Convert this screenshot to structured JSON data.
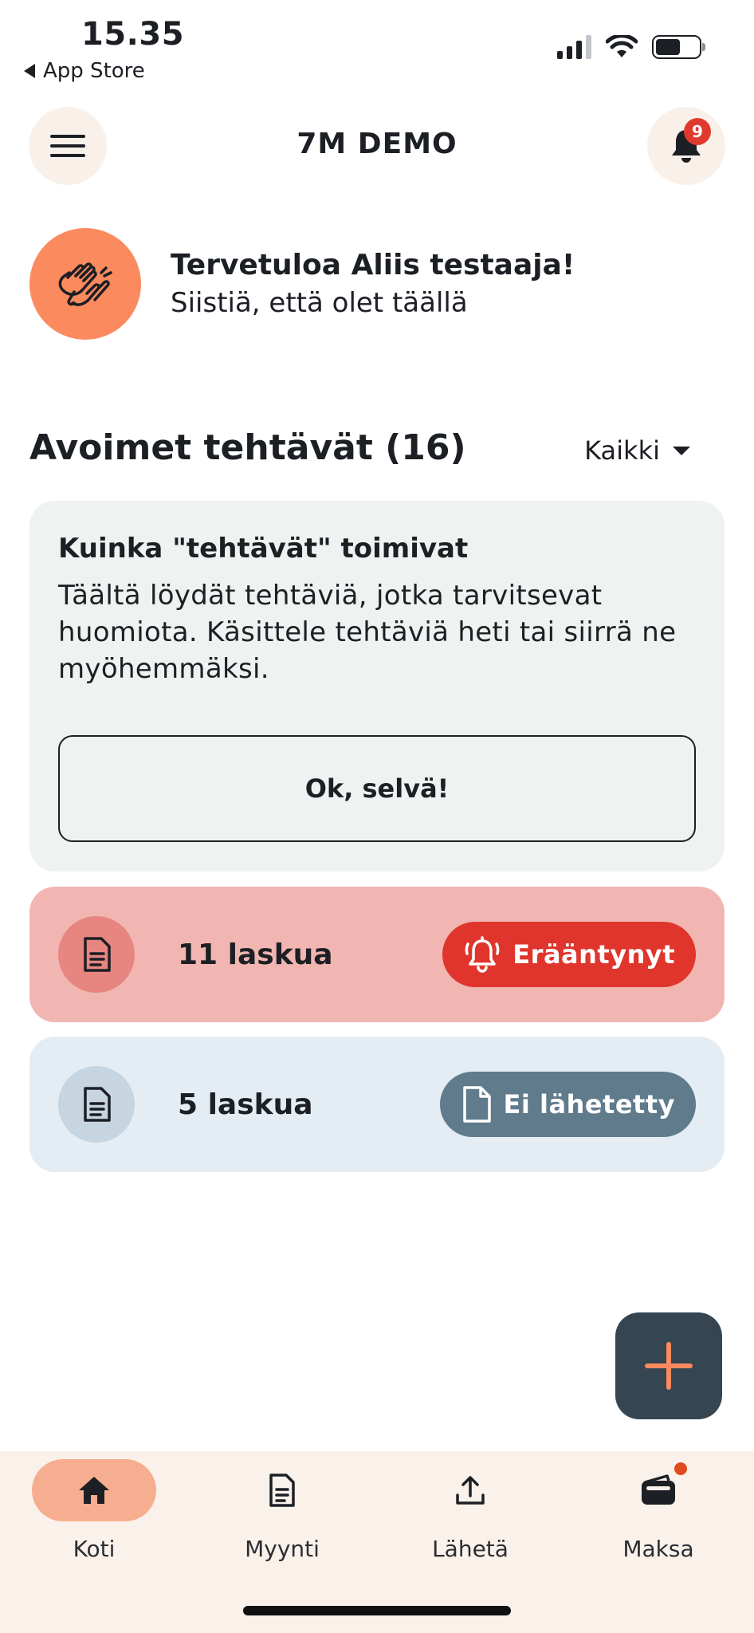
{
  "status_bar": {
    "time": "15.35",
    "back_label": "App Store"
  },
  "header": {
    "title": "7M DEMO",
    "notification_count": "9"
  },
  "welcome": {
    "title": "Tervetuloa Aliis testaaja!",
    "subtitle": "Siistiä, että olet täällä",
    "icon": "clapping-hands-icon"
  },
  "tasks": {
    "heading": "Avoimet tehtävät (16)",
    "filter_label": "Kaikki",
    "info_card": {
      "title": "Kuinka \"tehtävät\" toimivat",
      "text": "Täältä löydät tehtäviä, jotka tarvitsevat huomiota. Käsittele tehtäviä heti tai siirrä ne myöhemmäksi.",
      "button_label": "Ok, selvä!"
    },
    "items": [
      {
        "count_label": "11 laskua",
        "status_label": "Erääntynyt",
        "status_icon": "alarm-bell-icon",
        "status_color": "#e0352c"
      },
      {
        "count_label": "5 laskua",
        "status_label": "Ei lähetetty",
        "status_icon": "document-icon",
        "status_color": "#5f7b8c"
      }
    ]
  },
  "bottom_nav": {
    "items": [
      {
        "label": "Koti",
        "icon": "home-icon",
        "active": true
      },
      {
        "label": "Myynti",
        "icon": "document-icon",
        "active": false
      },
      {
        "label": "Lähetä",
        "icon": "upload-icon",
        "active": false
      },
      {
        "label": "Maksa",
        "icon": "wallet-icon",
        "active": false
      }
    ]
  },
  "colors": {
    "accent": "#fb8a5e",
    "fab": "#354552",
    "overdue_bg": "#f1b6b2",
    "unsent_bg": "#e4edf3"
  }
}
